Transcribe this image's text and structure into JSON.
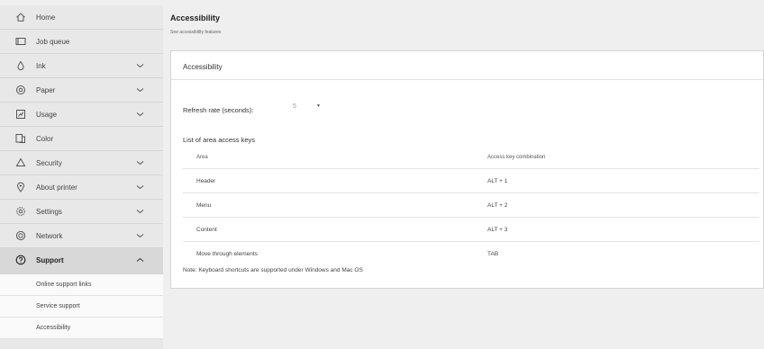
{
  "sidebar": {
    "items": [
      {
        "label": "Home",
        "icon": "home-icon"
      },
      {
        "label": "Job queue",
        "icon": "job-queue-icon"
      },
      {
        "label": "Ink",
        "icon": "ink-drop-icon"
      },
      {
        "label": "Paper",
        "icon": "paper-roll-icon"
      },
      {
        "label": "Usage",
        "icon": "usage-icon"
      },
      {
        "label": "Color",
        "icon": "color-icon"
      },
      {
        "label": "Security",
        "icon": "lock-icon"
      },
      {
        "label": "About printer",
        "icon": "info-location-icon"
      },
      {
        "label": "Settings",
        "icon": "gear-icon"
      },
      {
        "label": "Network",
        "icon": "globe-icon"
      },
      {
        "label": "Support",
        "icon": "help-icon"
      }
    ],
    "support_subitems": [
      "Online support links",
      "Service support",
      "Accessibility"
    ]
  },
  "page": {
    "title": "Accessibility",
    "subtitle": "See accessibility features"
  },
  "card": {
    "title": "Accessibility",
    "refresh_label": "Refresh rate (seconds):",
    "refresh_value": "5",
    "list_title": "List of area access keys",
    "table": {
      "headers": [
        "Area",
        "Access key combination"
      ],
      "rows": [
        [
          "Header",
          "ALT + 1"
        ],
        [
          "Menu",
          "ALT + 2"
        ],
        [
          "Content",
          "ALT + 3"
        ],
        [
          "Move through elements",
          "TAB"
        ]
      ]
    },
    "note": "Note: Keyboard shortcuts are supported under Windows and Mac OS"
  }
}
